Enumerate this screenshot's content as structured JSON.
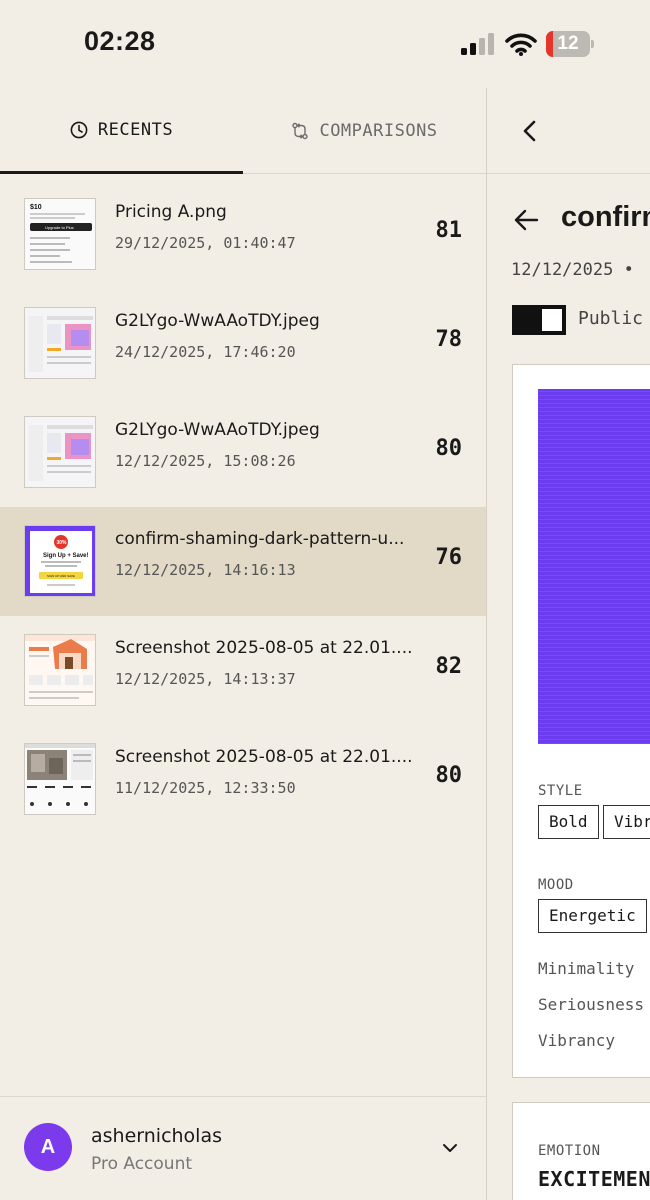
{
  "status_bar": {
    "time": "02:28",
    "battery_level": "12",
    "battery_color": "#e5352b",
    "icons": [
      "signal-icon",
      "wifi-icon",
      "battery-icon"
    ]
  },
  "tabs": [
    {
      "label": "RECENTS",
      "icon": "clock-icon",
      "active": true
    },
    {
      "label": "COMPARISONS",
      "icon": "compare-icon",
      "active": false
    }
  ],
  "recents": [
    {
      "title": "Pricing A.png",
      "date": "29/12/2025, 01:40:47",
      "score": "81",
      "selected": false
    },
    {
      "title": "G2LYgo-WwAAoTDY.jpeg",
      "date": "24/12/2025, 17:46:20",
      "score": "78",
      "selected": false
    },
    {
      "title": "G2LYgo-WwAAoTDY.jpeg",
      "date": "12/12/2025, 15:08:26",
      "score": "80",
      "selected": false
    },
    {
      "title": "confirm-shaming-dark-pattern-u...",
      "date": "12/12/2025, 14:16:13",
      "score": "76",
      "selected": true
    },
    {
      "title": "Screenshot 2025-08-05 at 22.01....",
      "date": "12/12/2025, 14:13:37",
      "score": "82",
      "selected": false
    },
    {
      "title": "Screenshot 2025-08-05 at 22.01....",
      "date": "11/12/2025, 12:33:50",
      "score": "80",
      "selected": false
    }
  ],
  "thumbnails": {
    "pricing_price": "$10",
    "pricing_cta": "Upgrade to Plus",
    "signup_badge": "30%",
    "signup_title": "Sign Up + Save!",
    "signup_cta": "SIGN UP AND SAVE"
  },
  "account": {
    "initial": "A",
    "username": "ashernicholas",
    "plan": "Pro Account",
    "avatar_color": "#7c3aed"
  },
  "detail": {
    "title": "confirm",
    "date": "12/12/2025 •",
    "public_label": "Public",
    "swatch_color": "#6c3cf0",
    "style_label": "STYLE",
    "style_chips": [
      "Bold",
      "Vibr"
    ],
    "mood_label": "MOOD",
    "mood_chips": [
      "Energetic"
    ],
    "metrics": [
      "Minimality",
      "Seriousness",
      "Vibrancy"
    ],
    "emotion_label": "EMOTION",
    "emotion_value": "EXCITEMEN"
  }
}
